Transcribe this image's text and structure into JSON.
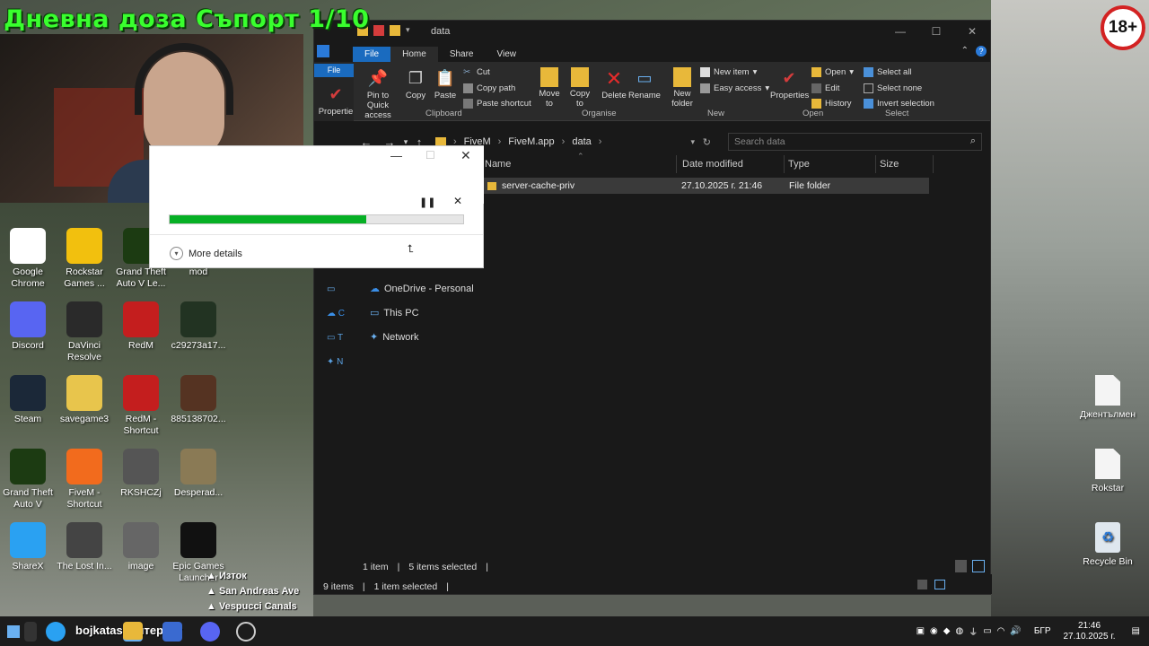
{
  "overlay_title": "Дневна доза Съпорт 1/10",
  "age_badge": "18+",
  "desktop_icons": [
    {
      "label": "Google Chrome",
      "color": "#fff"
    },
    {
      "label": "Rockstar Games ...",
      "color": "#f2c00e"
    },
    {
      "label": "Grand Theft Auto V Le...",
      "color": "#1c3b12"
    },
    {
      "label": "mod",
      "color": "#444"
    },
    {
      "label": "Discord",
      "color": "#5865f2"
    },
    {
      "label": "DaVinci Resolve",
      "color": "#2a2a2a"
    },
    {
      "label": "RedM",
      "color": "#c41e1e"
    },
    {
      "label": "c29273a17...",
      "color": "#223322"
    },
    {
      "label": "Steam",
      "color": "#1b2838"
    },
    {
      "label": "savegame3",
      "color": "#e8c54c"
    },
    {
      "label": "RedM - Shortcut",
      "color": "#c41e1e"
    },
    {
      "label": "885138702...",
      "color": "#553322"
    },
    {
      "label": "Grand Theft Auto V",
      "color": "#1c3b12"
    },
    {
      "label": "FiveM - Shortcut",
      "color": "#f26b1d"
    },
    {
      "label": "RKSHCZj",
      "color": "#555"
    },
    {
      "label": "Desperad...",
      "color": "#8a7a55"
    },
    {
      "label": "ShareX",
      "color": "#2aa1f2"
    },
    {
      "label": "The Lost In...",
      "color": "#444"
    },
    {
      "label": "image",
      "color": "#666"
    },
    {
      "label": "Epic Games Launcher",
      "color": "#111"
    }
  ],
  "right_icons": [
    "Джентълмен",
    "Rokstar",
    "Recycle Bin"
  ],
  "map_labels": [
    "Изток",
    "San Andreas Ave",
    "Vespucci Canals"
  ],
  "explorer": {
    "title": "data",
    "tabs": [
      "File",
      "Home",
      "Share",
      "View"
    ],
    "side_file_label": "File",
    "side_properties": "Propertie",
    "ribbon": {
      "pin": "Pin to Quick access",
      "copy": "Copy",
      "paste": "Paste",
      "cut": "Cut",
      "copy_path": "Copy path",
      "paste_shortcut": "Paste shortcut",
      "clipboard": "Clipboard",
      "move_to": "Move to",
      "copy_to": "Copy to",
      "delete": "Delete",
      "rename": "Rename",
      "organise": "Organise",
      "new_folder": "New folder",
      "new_item": "New item",
      "easy_access": "Easy access",
      "new": "New",
      "properties": "Properties",
      "open": "Open",
      "edit": "Edit",
      "history": "History",
      "open_group": "Open",
      "select_all": "Select all",
      "select_none": "Select none",
      "invert_selection": "Invert selection",
      "select_group": "Select"
    },
    "breadcrumb": [
      "FiveM",
      "FiveM.app",
      "data"
    ],
    "search_placeholder": "Search data",
    "columns": [
      "Name",
      "Date modified",
      "Type",
      "Size"
    ],
    "files": [
      {
        "name": "server-cache-priv",
        "date": "27.10.2025 г. 21:46",
        "type": "File folder",
        "size": ""
      }
    ],
    "nav": [
      "OneDrive - Personal",
      "This PC",
      "Network"
    ],
    "status_inner": [
      "1 item",
      "5 items selected"
    ],
    "status_outer": [
      "9 items",
      "1 item selected"
    ]
  },
  "progress_dialog": {
    "percent_complete": 0.67,
    "more_details": "More details"
  },
  "taskbar": {
    "search_text": "bojkatas: интернет",
    "lang": "БГР",
    "time": "21:46",
    "date": "27.10.2025 г."
  }
}
